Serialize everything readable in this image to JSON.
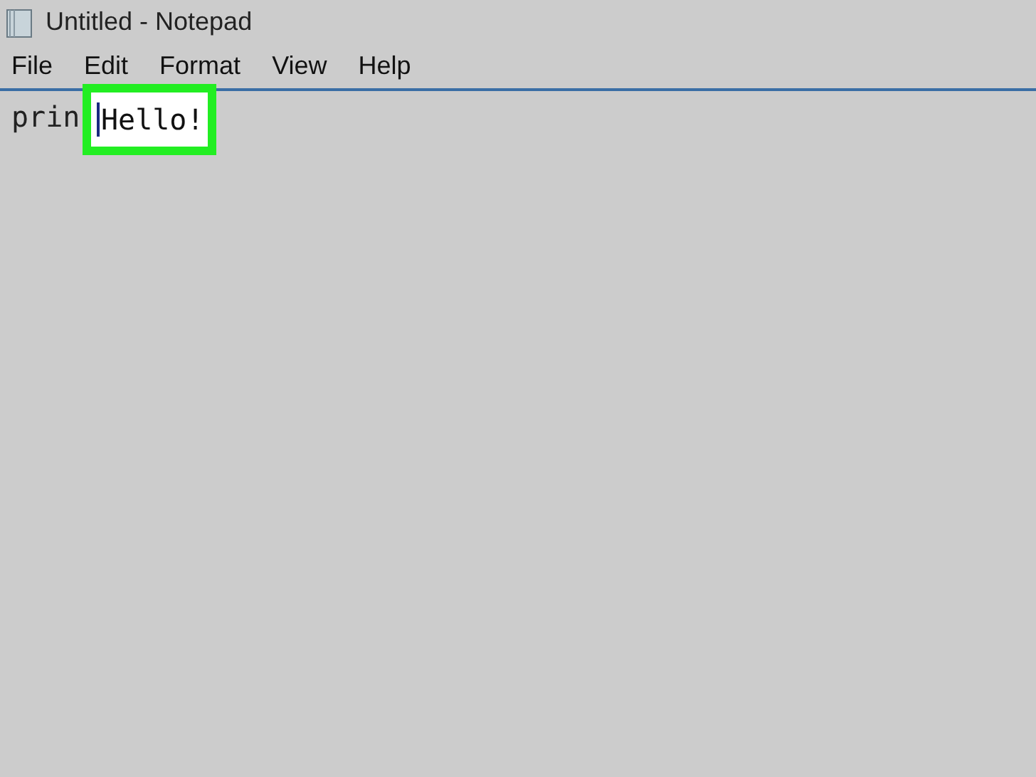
{
  "window": {
    "title": "Untitled - Notepad"
  },
  "menu": [
    "File",
    "Edit",
    "Format",
    "View",
    "Help"
  ],
  "editor": {
    "text": "prin",
    "highlight": {
      "text": "Hello!",
      "caret": true
    }
  }
}
